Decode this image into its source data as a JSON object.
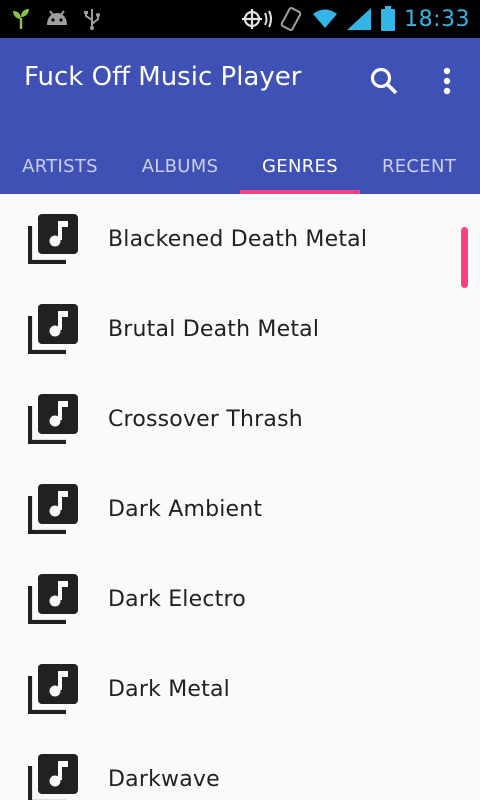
{
  "status_bar": {
    "time": "18:33",
    "icons": [
      "sprout-icon",
      "android-icon",
      "usb-icon",
      "gps-icon",
      "rotate-icon",
      "wifi-icon",
      "signal-icon",
      "battery-icon"
    ]
  },
  "app_bar": {
    "title": "Fuck Off Music Player",
    "search_icon": "search-icon",
    "more_icon": "more-vert-icon"
  },
  "tabs": [
    {
      "label": "ARTISTS",
      "active": false
    },
    {
      "label": "ALBUMS",
      "active": false
    },
    {
      "label": "GENRES",
      "active": true
    },
    {
      "label": "RECENT",
      "active": false
    }
  ],
  "genres": [
    {
      "label": "Blackened Death Metal",
      "icon": "library-music-icon"
    },
    {
      "label": "Brutal Death Metal",
      "icon": "library-music-icon"
    },
    {
      "label": "Crossover Thrash",
      "icon": "library-music-icon"
    },
    {
      "label": "Dark Ambient",
      "icon": "library-music-icon"
    },
    {
      "label": "Dark Electro",
      "icon": "library-music-icon"
    },
    {
      "label": "Dark Metal",
      "icon": "library-music-icon"
    },
    {
      "label": "Darkwave",
      "icon": "library-music-icon"
    }
  ],
  "colors": {
    "primary": "#3f51b5",
    "accent": "#ff4081",
    "status_icons": "#33b5e5",
    "background": "#fafafa",
    "text": "#212121"
  }
}
